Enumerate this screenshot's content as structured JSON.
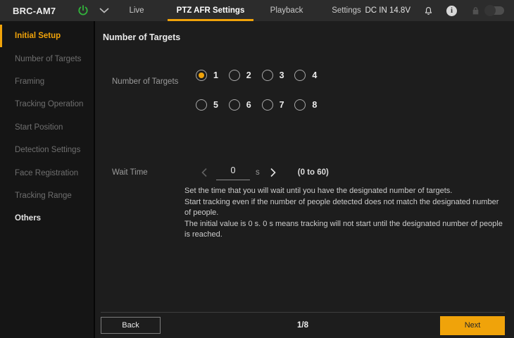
{
  "colors": {
    "accent": "#f0a30a",
    "power_green": "#32b43c"
  },
  "header": {
    "device_name": "BRC-AM7",
    "power_status": "DC IN 14.8V",
    "info_glyph": "i",
    "lock_toggle_state": "off",
    "tabs": [
      {
        "label": "Live",
        "active": false
      },
      {
        "label": "PTZ AFR Settings",
        "active": true
      },
      {
        "label": "Playback",
        "active": false
      },
      {
        "label": "Settings",
        "active": false
      }
    ]
  },
  "sidebar": {
    "items": [
      {
        "label": "Initial Setup",
        "state": "active"
      },
      {
        "label": "Number of Targets",
        "state": "dimmed"
      },
      {
        "label": "Framing",
        "state": "dimmed"
      },
      {
        "label": "Tracking Operation",
        "state": "dimmed"
      },
      {
        "label": "Start Position",
        "state": "dimmed"
      },
      {
        "label": "Detection Settings",
        "state": "dimmed"
      },
      {
        "label": "Face Registration",
        "state": "dimmed"
      },
      {
        "label": "Tracking Range",
        "state": "dimmed"
      },
      {
        "label": "Others",
        "state": "enabled"
      }
    ]
  },
  "main": {
    "section_title": "Number of Targets",
    "number_of_targets": {
      "label": "Number of Targets",
      "options": [
        "1",
        "2",
        "3",
        "4",
        "5",
        "6",
        "7",
        "8"
      ],
      "selected": "1"
    },
    "wait_time": {
      "label": "Wait Time",
      "value": "0",
      "unit": "s",
      "range_note": "(0 to 60)",
      "description_lines": [
        "Set the time that you will wait until you have the designated number of targets.",
        "Start tracking even if the number of people detected does not match the designated number of people.",
        "The initial value is 0 s. 0 s means tracking will not start until the designated number of people is reached."
      ]
    }
  },
  "footer": {
    "back_label": "Back",
    "page_indicator": "1/8",
    "next_label": "Next"
  }
}
